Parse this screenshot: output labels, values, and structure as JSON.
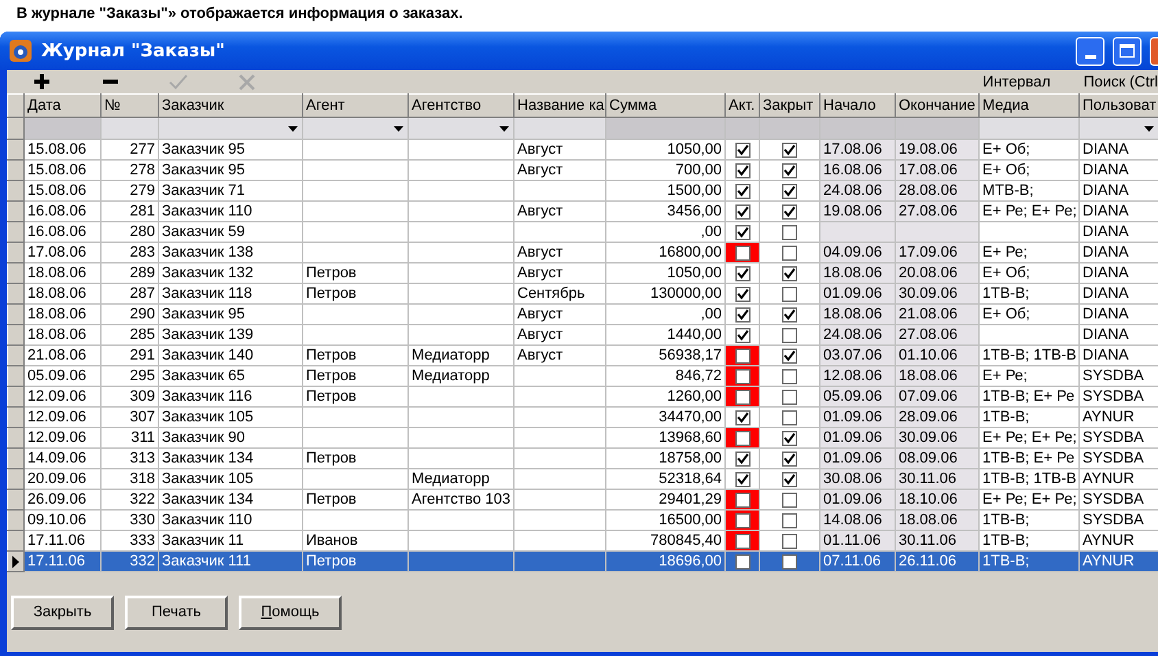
{
  "caption": "В журнале \"Заказы\"» отображается информация о заказах.",
  "window": {
    "title": "Журнал \"Заказы\""
  },
  "toolbar": {
    "buttons": [
      {
        "kind": "add",
        "disabled": false
      },
      {
        "kind": "remove",
        "disabled": false
      },
      {
        "kind": "confirm",
        "disabled": true
      },
      {
        "kind": "cancel",
        "disabled": true
      }
    ],
    "links": [
      "Интервал",
      "Поиск (Ctrl"
    ]
  },
  "table": {
    "columns": [
      {
        "label": "Дата",
        "filterable": false
      },
      {
        "label": "№",
        "filterable": true,
        "dropdown": false
      },
      {
        "label": "Заказчик",
        "filterable": true,
        "dropdown": true
      },
      {
        "label": "Агент",
        "filterable": true,
        "dropdown": true
      },
      {
        "label": "Агентство",
        "filterable": true,
        "dropdown": true
      },
      {
        "label": "Название ка",
        "filterable": true,
        "dropdown": false
      },
      {
        "label": "Сумма",
        "filterable": false
      },
      {
        "label": "Акт.",
        "filterable": false
      },
      {
        "label": "Закрыт",
        "filterable": false
      },
      {
        "label": "Начало",
        "filterable": false
      },
      {
        "label": "Окончание",
        "filterable": false
      },
      {
        "label": "Медиа",
        "filterable": true,
        "dropdown": false
      },
      {
        "label": "Пользоват",
        "filterable": true,
        "dropdown": true
      }
    ],
    "rows": [
      {
        "date": "15.08.06",
        "num": "277",
        "customer": "Заказчик 95",
        "campaign": "Август",
        "sum": "1050,00",
        "active": true,
        "closed": true,
        "start": "17.08.06",
        "end": "19.08.06",
        "media": "E+ Об;",
        "user": "DIANA",
        "selected": false
      },
      {
        "date": "15.08.06",
        "num": "278",
        "customer": "Заказчик 95",
        "campaign": "Август",
        "sum": "700,00",
        "active": true,
        "closed": true,
        "start": "16.08.06",
        "end": "17.08.06",
        "media": "E+ Об;",
        "user": "DIANA",
        "selected": false
      },
      {
        "date": "15.08.06",
        "num": "279",
        "customer": "Заказчик 71",
        "sum": "1500,00",
        "active": true,
        "closed": true,
        "start": "24.08.06",
        "end": "28.08.06",
        "media": "МТВ-В;",
        "user": "DIANA",
        "selected": false
      },
      {
        "date": "16.08.06",
        "num": "281",
        "customer": "Заказчик 110",
        "campaign": "Август",
        "sum": "3456,00",
        "active": true,
        "closed": true,
        "start": "19.08.06",
        "end": "27.08.06",
        "media": "E+ Ре; E+ Ре;",
        "user": "DIANA",
        "selected": false
      },
      {
        "date": "16.08.06",
        "num": "280",
        "customer": "Заказчик 59",
        "sum": ",00",
        "active": true,
        "closed": false,
        "user": "DIANA",
        "selected": false
      },
      {
        "date": "17.08.06",
        "num": "283",
        "customer": "Заказчик 138",
        "campaign": "Август",
        "sum": "16800,00",
        "active": false,
        "closed": false,
        "start": "04.09.06",
        "end": "17.09.06",
        "media": "E+ Ре;",
        "user": "DIANA",
        "selected": false
      },
      {
        "date": "18.08.06",
        "num": "289",
        "customer": "Заказчик 132",
        "agent": "Петров",
        "campaign": "Август",
        "sum": "1050,00",
        "active": true,
        "closed": true,
        "start": "18.08.06",
        "end": "20.08.06",
        "media": "E+ Об;",
        "user": "DIANA",
        "selected": false
      },
      {
        "date": "18.08.06",
        "num": "287",
        "customer": "Заказчик 118",
        "agent": "Петров",
        "campaign": "Сентябрь",
        "sum": "130000,00",
        "active": true,
        "closed": false,
        "start": "01.09.06",
        "end": "30.09.06",
        "media": "1ТВ-В;",
        "user": "DIANA",
        "selected": false
      },
      {
        "date": "18.08.06",
        "num": "290",
        "customer": "Заказчик 95",
        "campaign": "Август",
        "sum": ",00",
        "active": true,
        "closed": true,
        "start": "18.08.06",
        "end": "21.08.06",
        "media": "E+ Об;",
        "user": "DIANA",
        "selected": false
      },
      {
        "date": "18.08.06",
        "num": "285",
        "customer": "Заказчик 139",
        "campaign": "Август",
        "sum": "1440,00",
        "active": true,
        "closed": false,
        "start": "24.08.06",
        "end": "27.08.06",
        "user": "DIANA",
        "selected": false
      },
      {
        "date": "21.08.06",
        "num": "291",
        "customer": "Заказчик 140",
        "agent": "Петров",
        "agency": "Медиаторр",
        "campaign": "Август",
        "sum": "56938,17",
        "active": false,
        "closed": true,
        "start": "03.07.06",
        "end": "01.10.06",
        "media": "1ТВ-В; 1ТВ-В",
        "user": "DIANA",
        "selected": false
      },
      {
        "date": "05.09.06",
        "num": "295",
        "customer": "Заказчик 65",
        "agent": "Петров",
        "agency": "Медиаторр",
        "sum": "846,72",
        "active": false,
        "closed": false,
        "start": "12.08.06",
        "end": "18.08.06",
        "media": "E+ Ре;",
        "user": "SYSDBA",
        "selected": false
      },
      {
        "date": "12.09.06",
        "num": "309",
        "customer": "Заказчик 116",
        "agent": "Петров",
        "sum": "1260,00",
        "active": false,
        "closed": false,
        "start": "05.09.06",
        "end": "07.09.06",
        "media": "1ТВ-В; E+ Ре",
        "user": "SYSDBA",
        "selected": false
      },
      {
        "date": "12.09.06",
        "num": "307",
        "customer": "Заказчик 105",
        "sum": "34470,00",
        "active": true,
        "closed": false,
        "start": "01.09.06",
        "end": "28.09.06",
        "media": "1ТВ-В;",
        "user": "AYNUR",
        "selected": false
      },
      {
        "date": "12.09.06",
        "num": "311",
        "customer": "Заказчик 90",
        "sum": "13968,60",
        "active": false,
        "closed": true,
        "start": "01.09.06",
        "end": "30.09.06",
        "media": "E+ Ре; E+ Ре;",
        "user": "SYSDBA",
        "selected": false
      },
      {
        "date": "14.09.06",
        "num": "313",
        "customer": "Заказчик 134",
        "agent": "Петров",
        "sum": "18758,00",
        "active": true,
        "closed": true,
        "start": "01.09.06",
        "end": "08.09.06",
        "media": "1ТВ-В; E+ Ре",
        "user": "SYSDBA",
        "selected": false
      },
      {
        "date": "20.09.06",
        "num": "318",
        "customer": "Заказчик 105",
        "agency": "Медиаторр",
        "sum": "52318,64",
        "active": true,
        "closed": true,
        "start": "30.08.06",
        "end": "30.11.06",
        "media": "1ТВ-В; 1ТВ-В",
        "user": "AYNUR",
        "selected": false
      },
      {
        "date": "26.09.06",
        "num": "322",
        "customer": "Заказчик 134",
        "agent": "Петров",
        "agency": "Агентство 103",
        "sum": "29401,29",
        "active": false,
        "closed": false,
        "start": "01.09.06",
        "end": "18.10.06",
        "media": "E+ Ре; E+ Ре;",
        "user": "SYSDBA",
        "selected": false
      },
      {
        "date": "09.10.06",
        "num": "330",
        "customer": "Заказчик 110",
        "sum": "16500,00",
        "active": false,
        "closed": false,
        "start": "14.08.06",
        "end": "18.08.06",
        "media": "1ТВ-В;",
        "user": "SYSDBA",
        "selected": false
      },
      {
        "date": "17.11.06",
        "num": "333",
        "customer": "Заказчик 11",
        "agent": "Иванов",
        "sum": "780845,40",
        "active": false,
        "closed": false,
        "start": "01.11.06",
        "end": "30.11.06",
        "media": "1ТВ-В;",
        "user": "AYNUR",
        "selected": false
      },
      {
        "date": "17.11.06",
        "num": "332",
        "customer": "Заказчик 111",
        "agent": "Петров",
        "sum": "18696,00",
        "active": false,
        "closed": false,
        "start": "07.11.06",
        "end": "26.11.06",
        "media": "1ТВ-В;",
        "user": "AYNUR",
        "selected": true
      }
    ]
  },
  "buttons": [
    {
      "label": "Закрыть",
      "mnemonic": false
    },
    {
      "label": "Печать",
      "mnemonic": false
    },
    {
      "label": "Помощь",
      "mnemonic": true
    }
  ]
}
